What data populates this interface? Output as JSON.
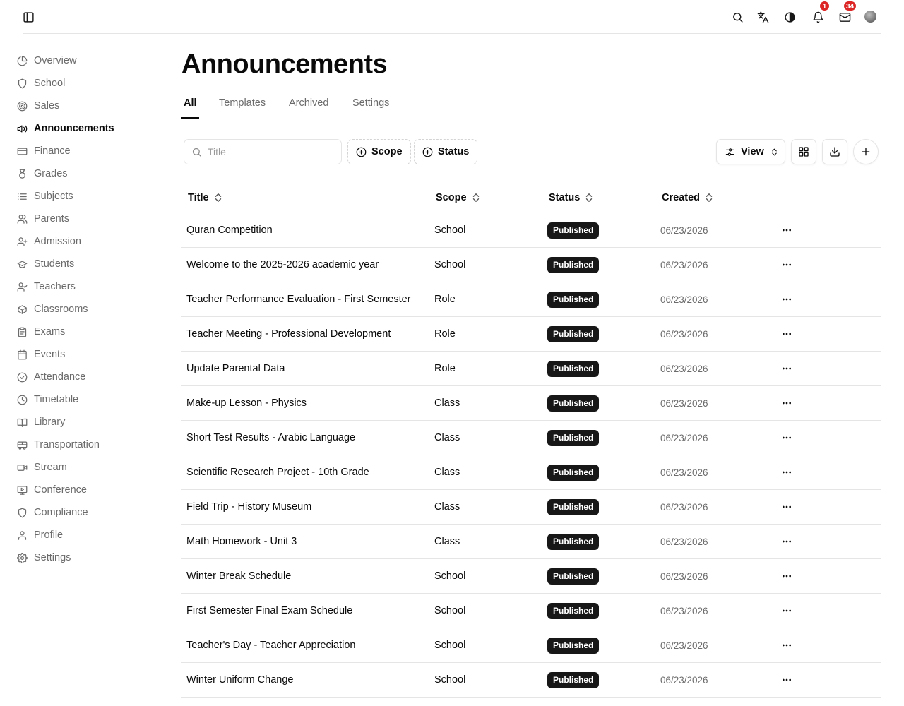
{
  "topbar": {
    "notifications_count": "1",
    "messages_count": "34"
  },
  "sidebar": {
    "items": [
      {
        "label": "Overview",
        "icon": "pie-chart-icon"
      },
      {
        "label": "School",
        "icon": "shield-icon"
      },
      {
        "label": "Sales",
        "icon": "target-icon"
      },
      {
        "label": "Announcements",
        "icon": "megaphone-icon",
        "active": true
      },
      {
        "label": "Finance",
        "icon": "credit-card-icon"
      },
      {
        "label": "Grades",
        "icon": "medal-icon"
      },
      {
        "label": "Subjects",
        "icon": "list-icon"
      },
      {
        "label": "Parents",
        "icon": "users-icon"
      },
      {
        "label": "Admission",
        "icon": "user-plus-icon"
      },
      {
        "label": "Students",
        "icon": "graduation-cap-icon"
      },
      {
        "label": "Teachers",
        "icon": "user-check-icon"
      },
      {
        "label": "Classrooms",
        "icon": "box-icon"
      },
      {
        "label": "Exams",
        "icon": "clipboard-icon"
      },
      {
        "label": "Events",
        "icon": "calendar-icon"
      },
      {
        "label": "Attendance",
        "icon": "check-circle-icon"
      },
      {
        "label": "Timetable",
        "icon": "clock-icon"
      },
      {
        "label": "Library",
        "icon": "book-open-icon"
      },
      {
        "label": "Transportation",
        "icon": "bus-icon"
      },
      {
        "label": "Stream",
        "icon": "video-icon"
      },
      {
        "label": "Conference",
        "icon": "presentation-icon"
      },
      {
        "label": "Compliance",
        "icon": "shield-icon"
      },
      {
        "label": "Profile",
        "icon": "user-icon"
      },
      {
        "label": "Settings",
        "icon": "gear-icon"
      }
    ]
  },
  "page": {
    "title": "Announcements"
  },
  "tabs": [
    {
      "label": "All",
      "active": true
    },
    {
      "label": "Templates"
    },
    {
      "label": "Archived"
    },
    {
      "label": "Settings"
    }
  ],
  "toolbar": {
    "search_placeholder": "Title",
    "scope_label": "Scope",
    "status_label": "Status",
    "view_label": "View"
  },
  "table": {
    "headers": [
      "Title",
      "Scope",
      "Status",
      "Created"
    ],
    "rows": [
      {
        "title": "Quran Competition",
        "scope": "School",
        "status": "Published",
        "created": "06/23/2026"
      },
      {
        "title": "Welcome to the 2025-2026 academic year",
        "scope": "School",
        "status": "Published",
        "created": "06/23/2026"
      },
      {
        "title": "Teacher Performance Evaluation - First Semester",
        "scope": "Role",
        "status": "Published",
        "created": "06/23/2026"
      },
      {
        "title": "Teacher Meeting - Professional Development",
        "scope": "Role",
        "status": "Published",
        "created": "06/23/2026"
      },
      {
        "title": "Update Parental Data",
        "scope": "Role",
        "status": "Published",
        "created": "06/23/2026"
      },
      {
        "title": "Make-up Lesson - Physics",
        "scope": "Class",
        "status": "Published",
        "created": "06/23/2026"
      },
      {
        "title": "Short Test Results - Arabic Language",
        "scope": "Class",
        "status": "Published",
        "created": "06/23/2026"
      },
      {
        "title": "Scientific Research Project - 10th Grade",
        "scope": "Class",
        "status": "Published",
        "created": "06/23/2026"
      },
      {
        "title": "Field Trip - History Museum",
        "scope": "Class",
        "status": "Published",
        "created": "06/23/2026"
      },
      {
        "title": "Math Homework - Unit 3",
        "scope": "Class",
        "status": "Published",
        "created": "06/23/2026"
      },
      {
        "title": "Winter Break Schedule",
        "scope": "School",
        "status": "Published",
        "created": "06/23/2026"
      },
      {
        "title": "First Semester Final Exam Schedule",
        "scope": "School",
        "status": "Published",
        "created": "06/23/2026"
      },
      {
        "title": "Teacher's Day - Teacher Appreciation",
        "scope": "School",
        "status": "Published",
        "created": "06/23/2026"
      },
      {
        "title": "Winter Uniform Change",
        "scope": "School",
        "status": "Published",
        "created": "06/23/2026"
      }
    ]
  }
}
